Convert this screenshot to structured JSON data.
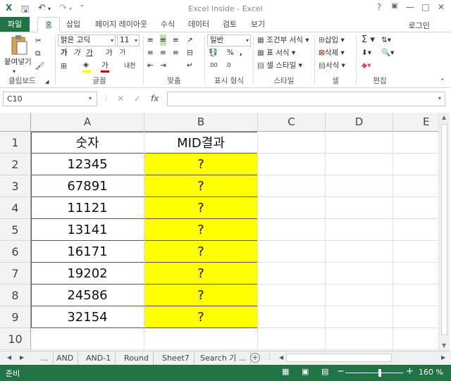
{
  "window": {
    "title": "Excel Inside - Excel",
    "help": "?",
    "minimize": "—",
    "restore": "□",
    "close": "✕"
  },
  "qat": {
    "save_icon": "save-icon",
    "undo_icon": "undo-icon",
    "redo_icon": "redo-icon"
  },
  "tabs": {
    "file": "파일",
    "items": [
      "홈",
      "삽입",
      "페이지 레이아웃",
      "수식",
      "데이터",
      "검토",
      "보기"
    ],
    "login": "로그인"
  },
  "ribbon": {
    "clipboard": {
      "paste": "붙여넣기",
      "label": "클립보드"
    },
    "font": {
      "name": "맑은 고딕",
      "size": "11",
      "bold": "가",
      "italic": "가",
      "underline": "가",
      "grow": "가",
      "shrink": "가",
      "color": "가",
      "label": "글꼴",
      "fill_color": "#ffff00",
      "font_color": "#c00000"
    },
    "alignment": {
      "label": "맞춤"
    },
    "number": {
      "format": "일반",
      "percent": "%",
      "label": "표시 형식"
    },
    "styles": {
      "conditional": "조건부 서식",
      "table": "표 서식",
      "cell": "셀 스타일",
      "label": "스타일"
    },
    "cells": {
      "insert": "삽입",
      "delete": "삭제",
      "format": "서식",
      "label": "셀"
    },
    "editing": {
      "label": "편집"
    }
  },
  "formula_bar": {
    "name_box": "C10",
    "cancel": "✕",
    "enter": "✓",
    "fx": "fx",
    "formula": ""
  },
  "sheet": {
    "columns": [
      "A",
      "B",
      "C",
      "D",
      "E"
    ],
    "rows": [
      "1",
      "2",
      "3",
      "4",
      "5",
      "6",
      "7",
      "8",
      "9",
      "10"
    ],
    "header_a": "숫자",
    "header_b": "MID결과",
    "values": [
      "12345",
      "67891",
      "11121",
      "13141",
      "16171",
      "19202",
      "24586",
      "32154"
    ],
    "results": [
      "?",
      "?",
      "?",
      "?",
      "?",
      "?",
      "?",
      "?"
    ],
    "highlight_color": "#ffff00"
  },
  "sheet_tabs": {
    "ellipsis_left": "...",
    "tabs": [
      "AND",
      "AND-1",
      "Round",
      "Sheet7",
      "Search 기 ..."
    ],
    "add": "+"
  },
  "status": {
    "ready": "준비",
    "zoom": "160 %",
    "minus": "−",
    "plus": "+",
    "zoom_level": 0.6
  }
}
